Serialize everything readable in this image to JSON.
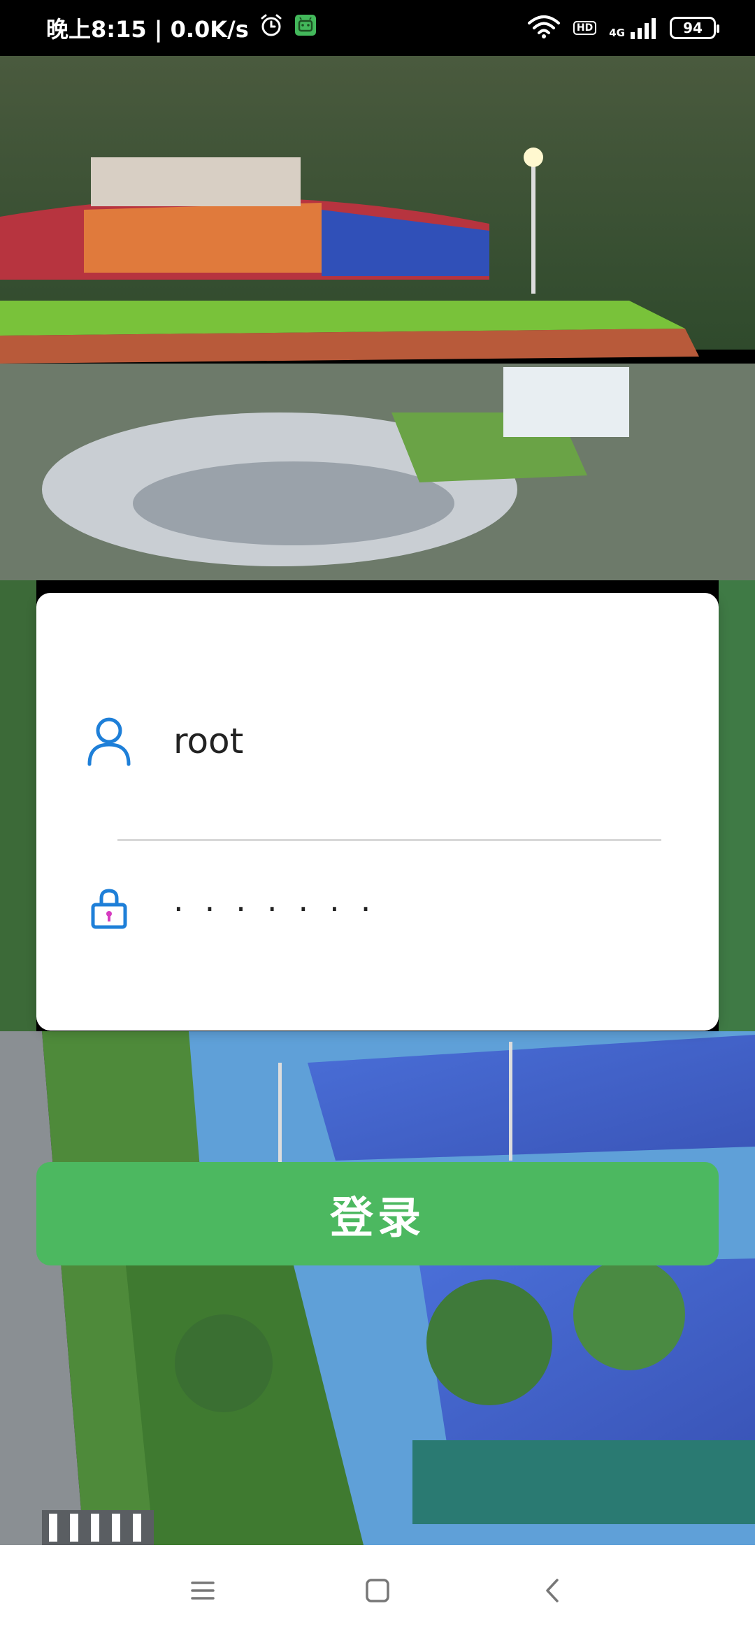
{
  "status_bar": {
    "time_speed": "晚上8:15 | 0.0K/s",
    "hd_label": "HD",
    "network_label": "4G",
    "battery_level": "94",
    "icons": [
      "alarm-icon",
      "android-notification-icon",
      "wifi-icon",
      "signal-icon",
      "battery-icon"
    ]
  },
  "login_form": {
    "username_value": "root",
    "password_masked": "·······",
    "icons": [
      "user-icon",
      "lock-icon"
    ],
    "login_button_label": "登录"
  },
  "colors": {
    "accent_green": "#4cb860",
    "icon_blue": "#1e7fd8",
    "icon_pink": "#d63cc0"
  },
  "nav_bar": {
    "icons": [
      "menu-icon",
      "home-icon",
      "back-icon"
    ]
  }
}
